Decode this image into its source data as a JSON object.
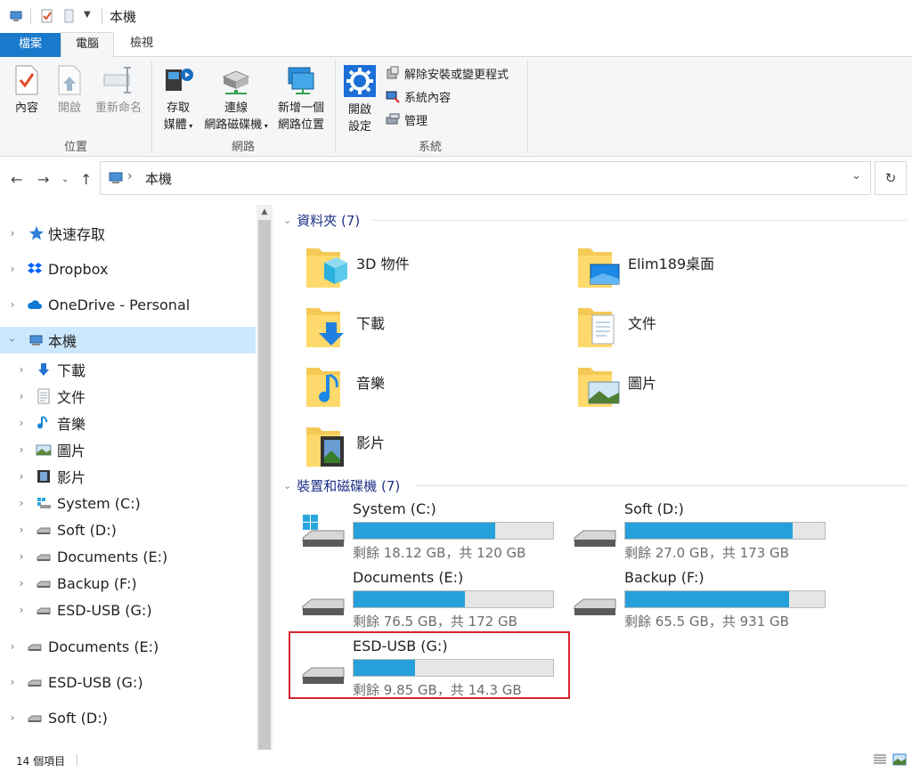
{
  "titlebar": {
    "title": "本機"
  },
  "tabs": {
    "file": "檔案",
    "computer": "電腦",
    "view": "檢視"
  },
  "ribbon": {
    "location": {
      "label": "位置",
      "properties": "內容",
      "open": "開啟",
      "rename": "重新命名"
    },
    "network": {
      "label": "網路",
      "media_1": "存取",
      "media_2": "媒體",
      "map_1": "連線",
      "map_2": "網路磁碟機",
      "addloc_1": "新增一個",
      "addloc_2": "網路位置"
    },
    "system": {
      "label": "系統",
      "settings_1": "開啟",
      "settings_2": "設定",
      "uninstall": "解除安裝或變更程式",
      "sysprops": "系統內容",
      "manage": "管理"
    }
  },
  "address": {
    "path": "本機"
  },
  "sidebar": {
    "items": [
      {
        "label": "快速存取"
      },
      {
        "label": "Dropbox"
      },
      {
        "label": "OneDrive - Personal"
      },
      {
        "label": "本機"
      },
      {
        "label": "下載"
      },
      {
        "label": "文件"
      },
      {
        "label": "音樂"
      },
      {
        "label": "圖片"
      },
      {
        "label": "影片"
      },
      {
        "label": "System (C:)"
      },
      {
        "label": "Soft (D:)"
      },
      {
        "label": "Documents (E:)"
      },
      {
        "label": "Backup (F:)"
      },
      {
        "label": "ESD-USB (G:)"
      },
      {
        "label": "Documents (E:)"
      },
      {
        "label": "ESD-USB (G:)"
      },
      {
        "label": "Soft (D:)"
      }
    ]
  },
  "main": {
    "folders_header": "資料夾 (7)",
    "folders": [
      {
        "name": "3D 物件"
      },
      {
        "name": "Elim189桌面"
      },
      {
        "name": "下載"
      },
      {
        "name": "文件"
      },
      {
        "name": "音樂"
      },
      {
        "name": "圖片"
      },
      {
        "name": "影片"
      }
    ],
    "drives_header": "裝置和磁碟機 (7)",
    "drives": [
      {
        "name": "System (C:)",
        "free": "剩餘 18.12 GB，共 120 GB",
        "used_fraction": 0.71
      },
      {
        "name": "Soft (D:)",
        "free": "剩餘 27.0 GB，共 173 GB",
        "used_fraction": 0.84
      },
      {
        "name": "Documents (E:)",
        "free": "剩餘 76.5 GB，共 172 GB",
        "used_fraction": 0.56
      },
      {
        "name": "Backup (F:)",
        "free": "剩餘 65.5 GB，共 931 GB",
        "used_fraction": 0.82
      },
      {
        "name": "ESD-USB (G:)",
        "free": "剩餘 9.85 GB，共 14.3 GB",
        "used_fraction": 0.31
      }
    ]
  },
  "status": {
    "count": "14 個項目"
  },
  "colors": {
    "accent": "#1979ca",
    "bar": "#26a0da",
    "selected": "#cce8ff",
    "highlight": "#d3242b"
  }
}
